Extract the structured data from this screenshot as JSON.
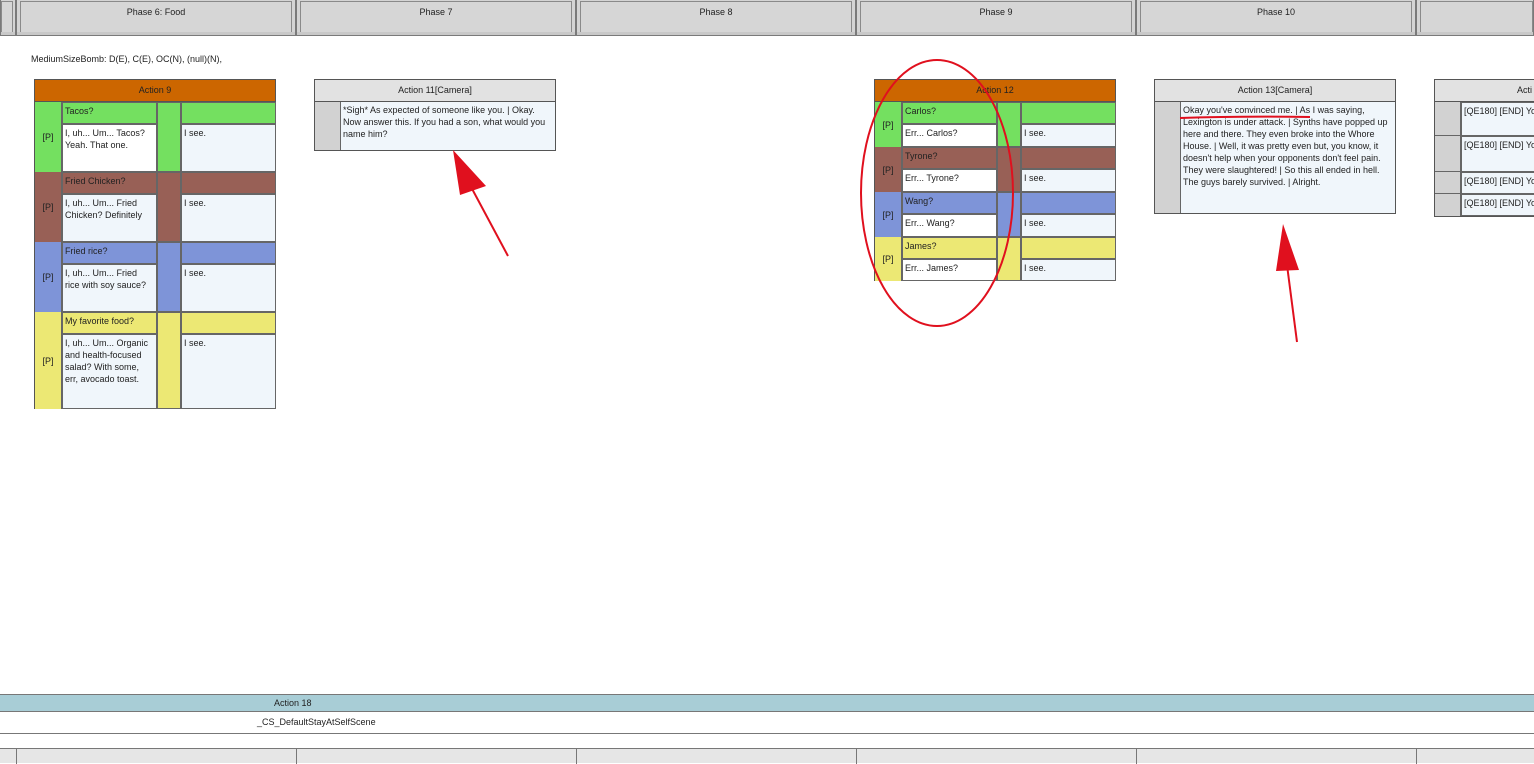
{
  "phases": [
    {
      "label": ""
    },
    {
      "label": "Phase 6: Food"
    },
    {
      "label": "Phase 7"
    },
    {
      "label": "Phase 8"
    },
    {
      "label": "Phase 9"
    },
    {
      "label": "Phase 10"
    },
    {
      "label": ""
    }
  ],
  "condition_text": "MediumSizeBomb: D(E), C(E), OC(N), (null)(N),",
  "action9": {
    "title": "Action 9",
    "rows": [
      {
        "tag": "[P]",
        "choice": "Tacos?",
        "line": "I, uh... Um... Tacos? Yeah. That one.",
        "reply": "I see."
      },
      {
        "tag": "[P]",
        "choice": "Fried Chicken?",
        "line": "I, uh... Um... Fried Chicken? Definitely",
        "reply": "I see."
      },
      {
        "tag": "[P]",
        "choice": "Fried rice?",
        "line": "I, uh... Um... Fried rice with soy sauce?",
        "reply": "I see."
      },
      {
        "tag": "[P]",
        "choice": "My favorite food?",
        "line": "I, uh... Um... Organic and health-focused salad? With some, err, avocado toast.",
        "reply": "I see."
      }
    ]
  },
  "action11": {
    "title": "Action 11[Camera]",
    "text": "*Sigh* As expected of someone like you. | Okay. Now answer this. If you had a son, what would you name him?"
  },
  "action12": {
    "title": "Action 12",
    "rows": [
      {
        "tag": "[P]",
        "choice": "Carlos?",
        "line": "Err... Carlos?",
        "reply": "I see."
      },
      {
        "tag": "[P]",
        "choice": "Tyrone?",
        "line": "Err... Tyrone?",
        "reply": "I see."
      },
      {
        "tag": "[P]",
        "choice": "Wang?",
        "line": "Err... Wang?",
        "reply": "I see."
      },
      {
        "tag": "[P]",
        "choice": "James?",
        "line": "Err... James?",
        "reply": "I see."
      }
    ]
  },
  "action13": {
    "title": "Action 13[Camera]",
    "text": "Okay you've convinced me. | As I was saying, Lexington is under attack. | Synths have popped up here and there. They even broke into the Whore House. | Well, it was pretty even but, you know, it doesn't help when your opponents don't feel pain. They were slaughtered! | So this all ended in hell. The guys barely survived. | Alright."
  },
  "action_partial": {
    "title": "Acti",
    "rows": [
      "[QE180] [END] Yo",
      "[QE180] [END] Yo",
      "[QE180] [END] Yo",
      "[QE180] [END] Yo"
    ]
  },
  "action18": {
    "title": "Action 18",
    "text": "_CS_DefaultStayAtSelfScene"
  },
  "colors": {
    "green": "#74e060",
    "brown": "#986056",
    "blue": "#7e94d8",
    "yellow": "#ece874",
    "orange_header": "#cc6600",
    "annotation_red": "#e0101e",
    "action18_bar": "#a8cdd6"
  }
}
